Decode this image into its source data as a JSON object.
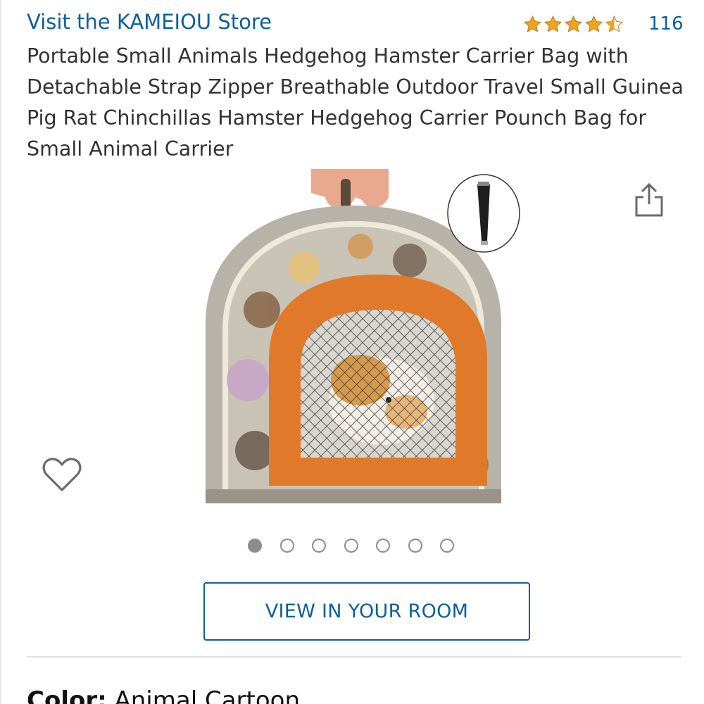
{
  "store": {
    "link_label": "Visit the KAMEIOU Store"
  },
  "rating": {
    "stars": 4.5,
    "review_count": "116",
    "star_color": "#f0a41b"
  },
  "product": {
    "title": "Portable Small Animals Hedgehog Hamster Carrier Bag with Detachable Strap Zipper Breathable Outdoor Travel Small Guinea Pig Rat Chinchillas Hamster Hedgehog Carrier Pounch Bag for Small Animal Carrier"
  },
  "gallery": {
    "image_count": 7,
    "active_index": 0
  },
  "actions": {
    "share_icon": "share-icon",
    "wishlist_icon": "heart-icon",
    "view_in_room_label": "VIEW IN YOUR ROOM"
  },
  "variation": {
    "label": "Color:",
    "value": "Animal Cartoon"
  },
  "colors": {
    "link": "#0f5f97",
    "text": "#333333",
    "star": "#f0a41b",
    "dot": "#8d8d8d"
  }
}
